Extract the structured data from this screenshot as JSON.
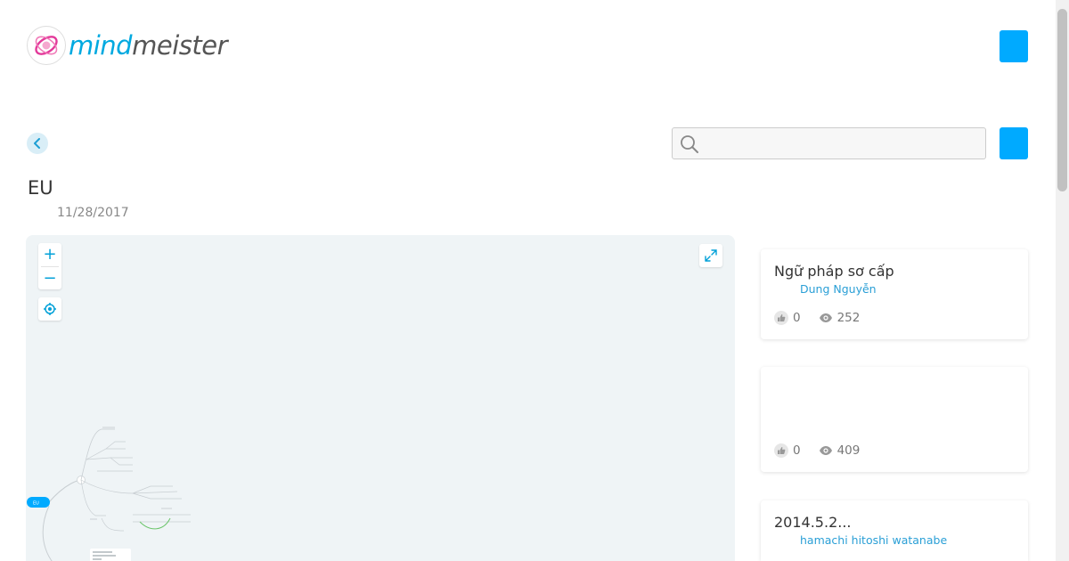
{
  "brand": {
    "logo_mind": "mind",
    "logo_meister": "meister"
  },
  "map": {
    "title": "EU",
    "date": "11/28/2017",
    "root_label": "EU"
  },
  "search": {
    "value": "",
    "placeholder": ""
  },
  "zoom": {
    "in": "+",
    "out": "−"
  },
  "icons": {
    "logo": "mindmeister-logo-icon",
    "back": "chevron-left-icon",
    "search": "search-icon",
    "center": "target-icon",
    "expand": "expand-icon",
    "likes": "thumbs-up-icon",
    "views": "eye-icon"
  },
  "colors": {
    "accent": "#00aaff",
    "canvas_bg": "#eff4f6",
    "link": "#2a9fd6",
    "root_node": "#00aaff",
    "connector": "#6bc56b"
  },
  "related": [
    {
      "title": "Ngữ pháp sơ cấp",
      "author": "Dung Nguyễn",
      "likes": "0",
      "views": "252"
    },
    {
      "title": "",
      "author": "",
      "likes": "0",
      "views": "409"
    },
    {
      "title": "2014.5.2...",
      "author": "hamachi hitoshi watanabe",
      "likes": "",
      "views": ""
    }
  ]
}
